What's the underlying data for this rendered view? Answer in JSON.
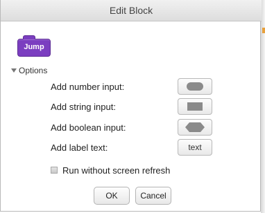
{
  "dialog": {
    "title": "Edit Block"
  },
  "block": {
    "label": "Jump",
    "color": "#7b3ec0"
  },
  "options": {
    "toggle_label": "Options",
    "expanded": true,
    "rows": [
      {
        "label": "Add number input:",
        "button": {
          "type": "oval-shape",
          "text": ""
        }
      },
      {
        "label": "Add string input:",
        "button": {
          "type": "rectangle-shape",
          "text": ""
        }
      },
      {
        "label": "Add boolean input:",
        "button": {
          "type": "hexagon-shape",
          "text": ""
        }
      },
      {
        "label": "Add label text:",
        "button": {
          "type": "text",
          "text": "text"
        }
      }
    ],
    "checkbox": {
      "label": "Run without screen refresh",
      "checked": false
    }
  },
  "buttons": {
    "ok": "OK",
    "cancel": "Cancel"
  }
}
